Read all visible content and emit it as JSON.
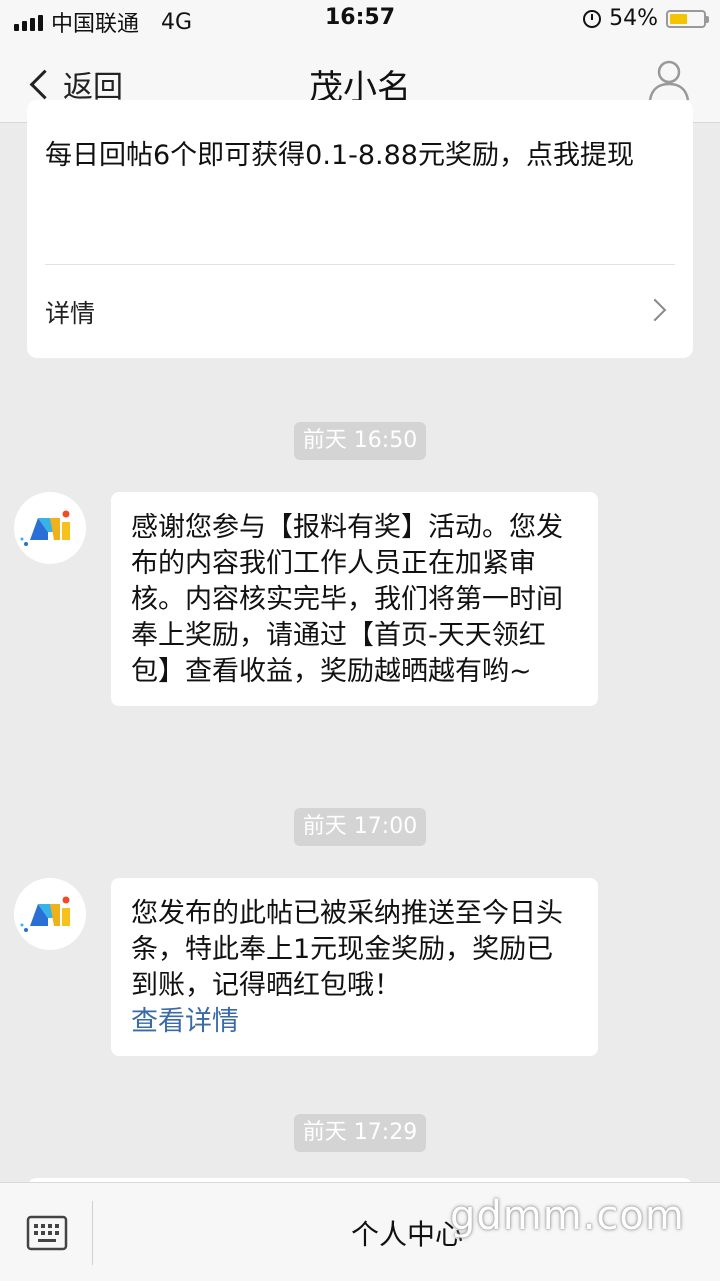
{
  "status_bar": {
    "carrier": "中国联通",
    "network": "4G",
    "time": "16:57",
    "battery": "54%",
    "battery_level": 0.54
  },
  "nav": {
    "back_label": "返回",
    "title": "茂小名"
  },
  "card": {
    "text": "每日回帖6个即可获得0.1-8.88元奖励，点我提现",
    "detail_label": "详情"
  },
  "messages": [
    {
      "time": "前天 16:50",
      "text": "感谢您参与【报料有奖】活动。您发布的内容我们工作人员正在加紧审核。内容核实完毕，我们将第一时间奉上奖励，请通过【首页-天天领红包】查看收益，奖励越晒越有哟~",
      "link": ""
    },
    {
      "time": "前天 17:00",
      "text": "您发布的此帖已被采纳推送至今日头条，特此奉上1元现金奖励，奖励已到账，记得晒红包哦！",
      "link": "查看详情"
    },
    {
      "time": "前天 17:29"
    }
  ],
  "bottom": {
    "menu_label": "个人中心"
  },
  "watermark": "gdmm.com",
  "colors": {
    "background": "#ebebeb",
    "link": "#3a6aa8",
    "battery": "#f4c400"
  }
}
